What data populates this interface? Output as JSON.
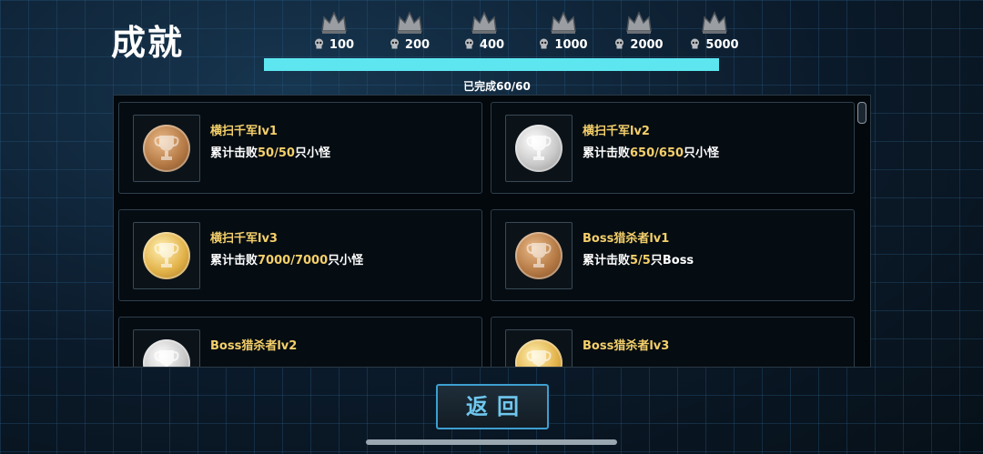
{
  "title": "成就",
  "milestones": [
    {
      "value": "100"
    },
    {
      "value": "200"
    },
    {
      "value": "400"
    },
    {
      "value": "1000"
    },
    {
      "value": "2000"
    },
    {
      "value": "5000"
    }
  ],
  "progress": {
    "label": "已完成60/60",
    "fraction": 1.0,
    "color": "#5de6f0"
  },
  "achievements": [
    {
      "name": "横扫千军lv1",
      "desc_prefix": "累计击败",
      "count": "50/50",
      "desc_suffix": "只小怪",
      "medal": "bronze"
    },
    {
      "name": "横扫千军lv2",
      "desc_prefix": "累计击败",
      "count": "650/650",
      "desc_suffix": "只小怪",
      "medal": "silver"
    },
    {
      "name": "横扫千军lv3",
      "desc_prefix": "累计击败",
      "count": "7000/7000",
      "desc_suffix": "只小怪",
      "medal": "gold"
    },
    {
      "name": "Boss猎杀者lv1",
      "desc_prefix": "累计击败",
      "count": "5/5",
      "desc_suffix": "只Boss",
      "medal": "bronze"
    },
    {
      "name": "Boss猎杀者lv2",
      "medal": "silver"
    },
    {
      "name": "Boss猎杀者lv3",
      "medal": "gold"
    }
  ],
  "back_button": {
    "label": "返回"
  },
  "colors": {
    "highlight": "#f5d06a",
    "accent": "#3d9fd0"
  }
}
